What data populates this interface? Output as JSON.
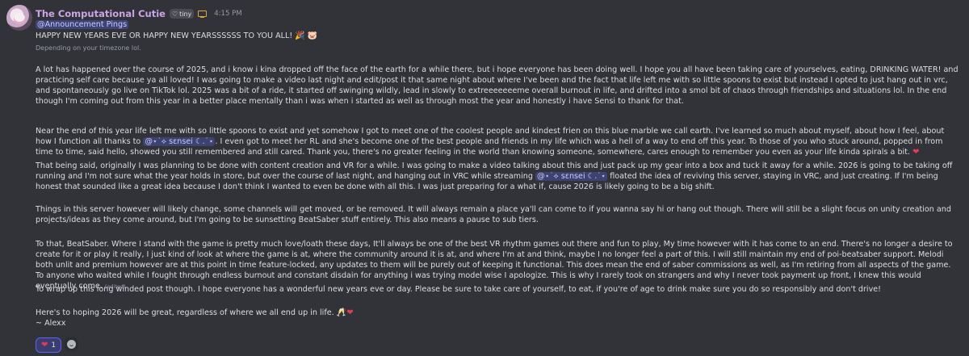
{
  "author": {
    "name": "The Computational Cutie",
    "tag": "tiny",
    "time": "4:15 PM"
  },
  "mention_role": "@Announcement Pings",
  "headline": "HAPPY NEW YEARS EVE OR HAPPY NEW YEARSSSSSS TO YOU ALL!",
  "subtext": "Depending on your timezone lol.",
  "p1": "A lot has happened over the course of 2025, and i know i kina dropped off the face of the earth for a while there, but i hope everyone has been doing well. I hope you all have been taking care of yourselves, eating, DRINKING WATER! and practicing self care because ya all loved! I was going to make a video last night and edit/post it that same night about where I've been and the fact that life left me with so little spoons to exist but instead I opted to just hang out in vrc, and spontaneously go live on TikTok lol. 2025 was a bit of a ride, it started off swinging wildly, lead in slowly to extreeeeeeeme overall burnout in life, and drifted into a smol bit of chaos through friendships and situations lol. In the end though I'm coming out from this year in a better place mentally than i was when i started as well as through most the year and honestly i have Sensi to thank for that.",
  "p2a": "Near the end of this year life left me with so little spoons to exist and yet somehow I got to meet one of the coolest people and kindest frien on this blue marble we call earth. I've learned so much about myself, about how I feel, about how I function all thanks to",
  "mention_user": "@⋆˙⟡ sɛnsei ☾.˙⋆",
  "p2b": ". I even got to meet her RL and she's become one of the best people and friends in my life which was a hell of a way to end off this year. To those of you who stuck around, popped in from time to time, said hello, showed you still remembered and still cared. Thank you, there's no greater feeling in the world than knowing someone, somewhere, cares enough to remember you even as your life kinda spirals a bit.",
  "p3a": "That being said, originally I was planning to be done with content creation and VR for a while. I was going to make a video talking about this and just pack up my gear into a box and tuck it away for a while. 2026 is going to be taking off running and I'm not sure what the year holds in store, but over the course of last night, and hanging out in VRC while streaming",
  "p3b": "floated the idea of reviving this server, staying in VRC, and just creating. If I'm being honest that sounded like a great idea because I don't think I wanted to even be done with all this. I was just preparing for a what if, cause 2026 is likely going to be a big shift.",
  "p4": "Things in this server however will likely change, some channels will get moved, or be removed. It will always remain a place ya'll can come to if you wanna say hi or hang out though. There will still be a slight focus on unity creation and projects/ideas as they come around, but I'm going to be sunsetting BeatSaber stuff entirely. This also means a pause to sub tiers.",
  "p5": "To that, BeatSaber. Where I stand with the game is pretty much love/loath these days, It'll always be one of the best VR rhythm games out there and fun to play, My time however with it has come to an end. There's no longer a desire to create for it or play it really, I just kind of look at where the game is at, where the community around it is at, and where I'm at and think, maybe I no longer feel a part of this. I will still maintain my end of poi-beatsaber support. Melodi both unlit and premium however are at this point in time feature-locked, any updates to them will be purely out of keeping it functional. This does mean the end of saber commissions as well, as I'm retiring from all aspects of the game. To anyone who waited while I fought through endless burnout and constant disdain for anything i was trying model wise I apologize. This is why I rarely took on strangers and why I never took payment up front, I knew this would eventually come.",
  "edited": "(edited)",
  "p6": "To wrap up this long winded post though. I hope everyone has a wonderful new years eve or day. Please be sure to take care of yourself, to eat, if you're of age to drink make sure you do so responsibly and don't drive!",
  "p7": "Here's to hoping 2026 will be great, regardless of where we all end up in life.",
  "signoff": "~ Alexx",
  "reaction_count": "1",
  "colors": {
    "background": "#323339",
    "username": "#c9a5e8",
    "mention_bg": "#3f4377",
    "heart": "#e23b58"
  }
}
